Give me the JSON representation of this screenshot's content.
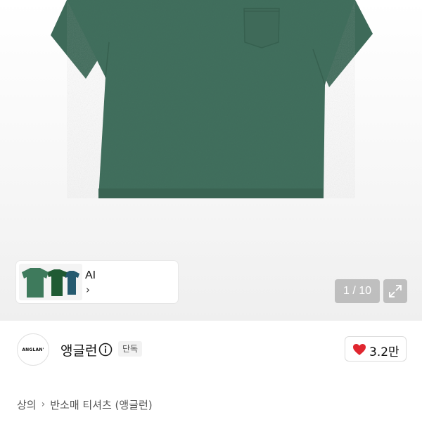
{
  "gallery": {
    "ai_card": {
      "label": "AI",
      "chevron": "›"
    },
    "counter": "1 / 10",
    "expand_icon": "expand-icon",
    "shirt_color": "#3f6b5a"
  },
  "brand": {
    "logo_text": "ANGLAN'",
    "name": "앵글런",
    "info_icon": "info-icon",
    "badge": "단독"
  },
  "like": {
    "icon": "heart-icon",
    "count": "3.2만",
    "color": "#e0262f"
  },
  "breadcrumb": {
    "items": [
      "상의",
      "반소매 티셔츠 (앵글런)"
    ],
    "separator": "›"
  }
}
